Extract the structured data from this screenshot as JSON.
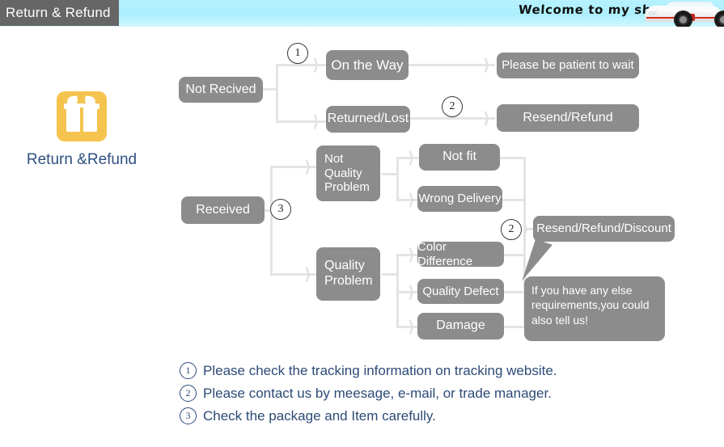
{
  "header": {
    "tab_title": "Return & Refund",
    "welcome_text": "Welcome to my shop",
    "tab_bg_color": "#666666",
    "band_color": "#a8efff"
  },
  "gift": {
    "label": "Return &Refund",
    "icon_name": "gift-icon",
    "icon_color": "#f5c44e",
    "label_color": "#2f4f7f"
  },
  "flow": {
    "node_color": "#8c8c8c",
    "connector_color": "#e4e4e4",
    "nodes": {
      "not_received": "Not Recived",
      "on_the_way": "On the Way",
      "returned_lost": "Returned/Lost",
      "please_wait": "Please be patient to wait",
      "resend_refund": "Resend/Refund",
      "received": "Received",
      "not_quality_problem": "Not\nQuality\nProblem",
      "quality_problem": "Quality\nProblem",
      "not_fit": "Not fit",
      "wrong_delivery": "Wrong Delivery",
      "color_difference": "Color Difference",
      "quality_defect": "Quality Defect",
      "damage": "Damage",
      "resend_refund_discount": "Resend/Refund/Discount"
    },
    "markers": {
      "m1": "1",
      "m2_top": "2",
      "m3": "3",
      "m2_right": "2"
    },
    "bubble_text": "If you have any else requirements,you could also tell us!"
  },
  "legend": {
    "items": [
      {
        "num": "1",
        "text": "Please check the tracking information on tracking website."
      },
      {
        "num": "2",
        "text": "Please contact us by meesage, e-mail, or trade manager."
      },
      {
        "num": "3",
        "text": "Check the package and Item carefully."
      }
    ],
    "text_color": "#2c4a76"
  }
}
